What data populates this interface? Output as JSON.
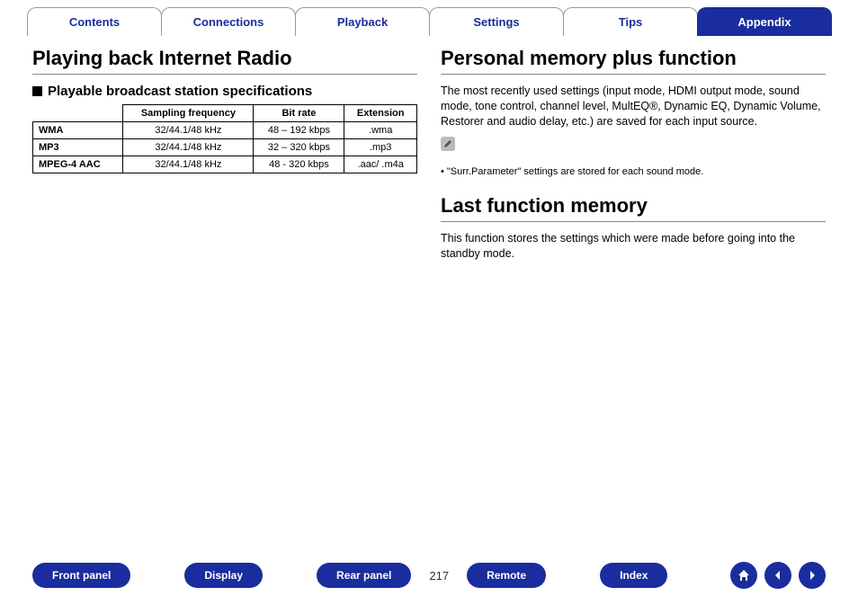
{
  "tabs": {
    "contents": "Contents",
    "connections": "Connections",
    "playback": "Playback",
    "settings": "Settings",
    "tips": "Tips",
    "appendix": "Appendix"
  },
  "left": {
    "heading": "Playing back Internet Radio",
    "subhead": "Playable broadcast station specifications",
    "table": {
      "headers": {
        "freq": "Sampling frequency",
        "rate": "Bit rate",
        "ext": "Extension"
      },
      "rows": [
        {
          "fmt": "WMA",
          "freq": "32/44.1/48 kHz",
          "rate": "48 – 192 kbps",
          "ext": ".wma"
        },
        {
          "fmt": "MP3",
          "freq": "32/44.1/48 kHz",
          "rate": "32 – 320 kbps",
          "ext": ".mp3"
        },
        {
          "fmt": "MPEG-4 AAC",
          "freq": "32/44.1/48 kHz",
          "rate": "48 - 320 kbps",
          "ext": ".aac/ .m4a"
        }
      ]
    }
  },
  "right": {
    "heading1": "Personal memory plus function",
    "para1": "The most recently used settings (input mode, HDMI output mode, sound mode, tone control, channel level, MultEQ®, Dynamic EQ, Dynamic Volume, Restorer and audio delay, etc.) are saved for each input source.",
    "note": "• \"Surr.Parameter\" settings are stored for each sound mode.",
    "heading2": "Last function memory",
    "para2": "This function stores the settings which were made before going into the standby mode."
  },
  "bottom": {
    "front": "Front panel",
    "display": "Display",
    "rear": "Rear panel",
    "page": "217",
    "remote": "Remote",
    "index": "Index"
  }
}
